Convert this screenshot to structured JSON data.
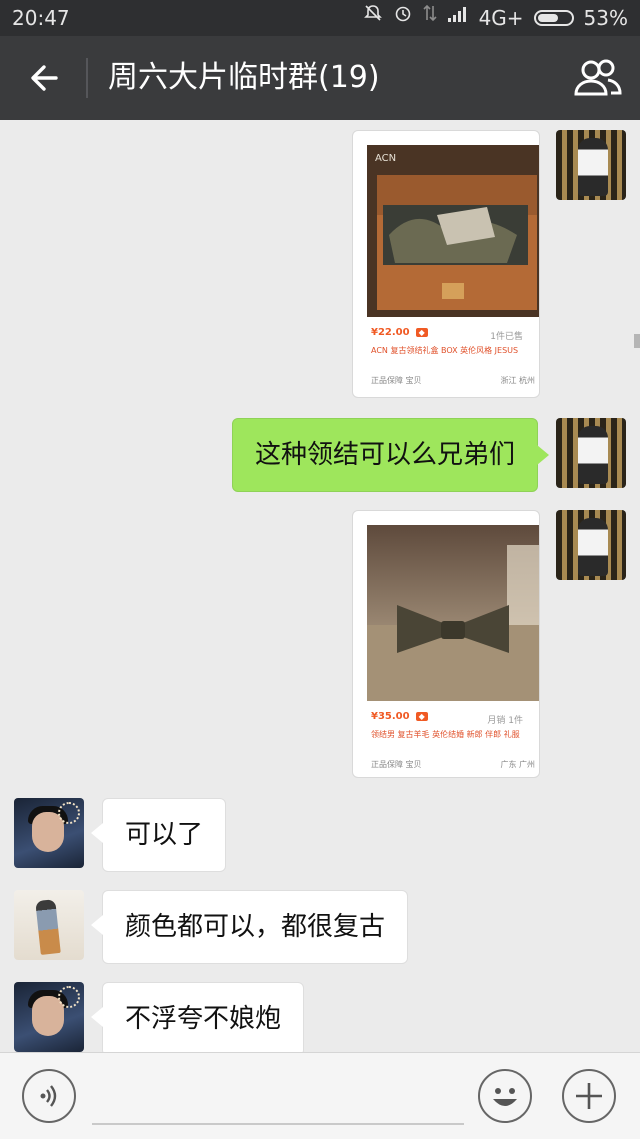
{
  "status_bar": {
    "time": "20:47",
    "network": "4G+",
    "battery": "53%",
    "icons": [
      "mute-icon",
      "alarm-icon",
      "data-transfer-icon",
      "signal-icon",
      "battery-icon"
    ]
  },
  "header": {
    "title": "周六大片临时群(19)",
    "back_icon": "back-arrow-icon",
    "group_icon": "group-members-icon"
  },
  "messages": [
    {
      "kind": "product-card",
      "direction": "out",
      "price": "¥22.00",
      "sold": "1件已售",
      "desc": "ACN 复古领结礼盒 BOX 英伦风格 JESUS",
      "meta_left": "正品保障 宝贝",
      "meta_right": "浙江 杭州"
    },
    {
      "kind": "text",
      "direction": "out",
      "text": "这种领结可以么兄弟们"
    },
    {
      "kind": "product-card",
      "direction": "out",
      "price": "¥35.00",
      "sold": "月销 1件",
      "desc": "领结男 复古羊毛 英伦结婚 新郎 伴郎 礼服",
      "meta_left": "正品保障 宝贝",
      "meta_right": "广东 广州"
    },
    {
      "kind": "text",
      "direction": "in",
      "text": "可以了"
    },
    {
      "kind": "text",
      "direction": "in",
      "text": "颜色都可以，都很复古"
    },
    {
      "kind": "text",
      "direction": "in",
      "text": "不浮夸不娘炮"
    }
  ],
  "input_bar": {
    "voice_icon": "voice-input-icon",
    "emoji_icon": "emoji-icon",
    "plus_icon": "plus-icon",
    "text_value": ""
  },
  "colors": {
    "status_bar_bg": "#2e2f31",
    "header_bg": "#3a3b3d",
    "chat_bg": "#ebebeb",
    "outgoing_bubble": "#9ee65c",
    "incoming_bubble": "#ffffff",
    "price_accent": "#f05a24"
  }
}
